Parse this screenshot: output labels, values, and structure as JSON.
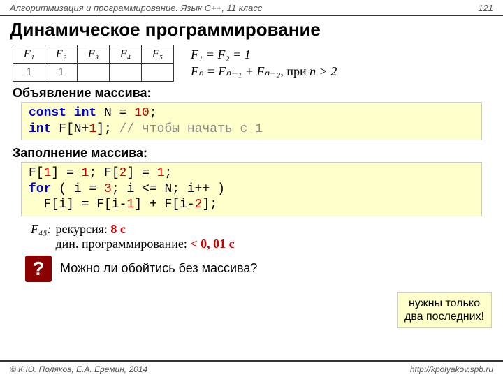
{
  "header": {
    "left": "Алгоритмизация и программирование. Язык C++, 11 класс",
    "right": "121"
  },
  "title": "Динамическое программирование",
  "fib_headers": [
    "F₁",
    "F₂",
    "F₃",
    "F₄",
    "F₅"
  ],
  "fib_values": [
    "1",
    "1",
    "",
    "",
    ""
  ],
  "formula1": "F₁ = F₂ = 1",
  "formula2_a": "Fₙ = Fₙ₋₁ + Fₙ₋₂",
  "formula2_b": ", при ",
  "formula2_c": "n > 2",
  "sect1": "Объявление массива:",
  "code1": {
    "l1a": "const int",
    "l1b": " N ",
    "l1c": "=",
    "l1d": " 10",
    "l1e": ";",
    "l2a": "int",
    "l2b": " F[N+",
    "l2c": "1",
    "l2d": "]; ",
    "l2e": "// чтобы начать с 1"
  },
  "sect2": "Заполнение массива:",
  "code2": {
    "l1": "F[",
    "l1n1": "1",
    "l1b": "] = ",
    "l1n2": "1",
    "l1c": "; F[",
    "l1n3": "2",
    "l1d": "] = ",
    "l1n4": "1",
    "l1e": ";",
    "l2a": "for",
    "l2b": " ( i = ",
    "l2n1": "3",
    "l2c": "; i <= N; i++ )",
    "l3": "  F[i] = F[i-",
    "l3n1": "1",
    "l3b": "] + F[i-",
    "l3n2": "2",
    "l3c": "];"
  },
  "f45_label": "F₄₅:",
  "f45_l1a": "рекурсия: ",
  "f45_l1b": "8 с",
  "f45_l2a": "дин. программирование: ",
  "f45_l2b": "< 0, 01 с",
  "note_l1": "нужны только",
  "note_l2": "два последних!",
  "question": "Можно ли обойтись без массива?",
  "qmark": "?",
  "footer": {
    "left": "© К.Ю. Поляков, Е.А. Еремин, 2014",
    "right": "http://kpolyakov.spb.ru"
  }
}
